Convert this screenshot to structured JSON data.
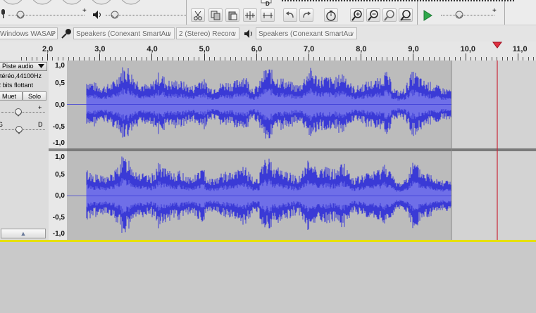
{
  "colors": {
    "waveform": "#3a3ad6",
    "waveform_rms": "#6f6fe8",
    "track_bg": "#bcbcbc",
    "empty_bg": "#d3d3d3",
    "playhead": "#c8283a",
    "selection_border": "#e6e000",
    "play_green": "#2ea84a"
  },
  "toolbar": {
    "meter_plus": "+",
    "slider_plus": "+"
  },
  "device_bar": {
    "host": "Windows WASAP",
    "recording_device": "Speakers (Conexant SmartAu",
    "channels": "2 (Stereo) Recorc",
    "playback_device": "Speakers (Conexant SmartAu"
  },
  "ruler": {
    "ticks": [
      "2,0",
      "3,0",
      "4,0",
      "5,0",
      "6,0",
      "7,0",
      "8,0",
      "9,0",
      "10,0",
      "11,0"
    ]
  },
  "track": {
    "name": "Piste audio",
    "format_line1": "Stéréo,44100Hz",
    "format_line2": "32 bits flottant",
    "mute_label": "Muet",
    "solo_label": "Solo",
    "gain_plus": "+",
    "pan_left": "G",
    "pan_right": "D",
    "collapse_glyph": "▲"
  },
  "vertical_ruler": {
    "channel1": [
      "1,0",
      "0,5",
      "0,0",
      "-0,5",
      "-1,0"
    ],
    "channel2": [
      "1,0",
      "0,5",
      "0,0",
      "-0,5",
      "-1,0"
    ]
  }
}
